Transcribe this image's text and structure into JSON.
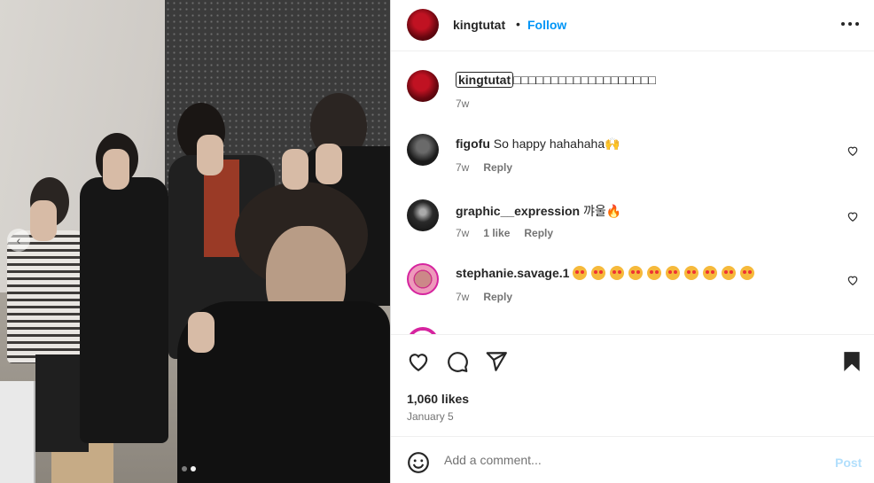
{
  "post_header": {
    "username": "kingtutat",
    "separator": "•",
    "follow_label": "Follow",
    "more_icon": "more-horizontal-icon"
  },
  "caption": {
    "username": "kingtutat",
    "text": "□□□□□□□□□□□□□□□□□□□",
    "time": "7w"
  },
  "comments": [
    {
      "username": "figofu",
      "text": "So happy hahahaha🙌",
      "time": "7w",
      "likes": "",
      "reply_label": "Reply"
    },
    {
      "username": "graphic__expression",
      "text": "꺄울🔥",
      "time": "7w",
      "likes": "1 like",
      "reply_label": "Reply"
    },
    {
      "username": "stephanie.savage.1",
      "text": "",
      "emoji_count": 10,
      "time": "7w",
      "likes": "",
      "reply_label": "Reply"
    }
  ],
  "actions": {
    "icons": [
      "heart-icon",
      "comment-icon",
      "share-icon",
      "bookmark-icon"
    ],
    "likes": "1,060 likes",
    "date": "January 5"
  },
  "add_comment": {
    "placeholder": "Add a comment...",
    "post_label": "Post"
  },
  "carousel": {
    "slide_count": 2,
    "active_slide": 2
  },
  "colors": {
    "link_blue": "#0095f6",
    "post_disabled": "#b2dffc",
    "muted_text": "#737373"
  }
}
